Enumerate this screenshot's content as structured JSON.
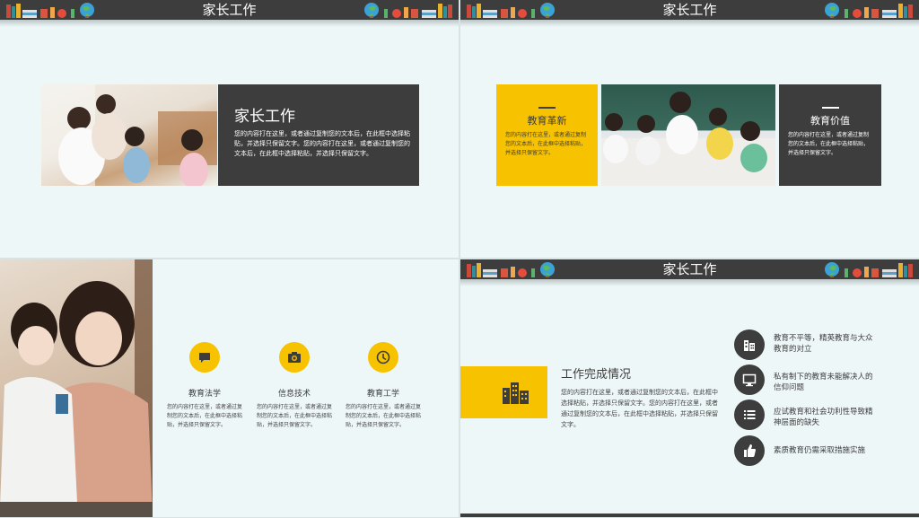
{
  "colors": {
    "dark": "#3d3d3d",
    "accent": "#f7c200",
    "bg": "#eef7f8"
  },
  "slide1": {
    "header_title": "家长工作",
    "card_title": "家长工作",
    "card_text": "您的内容打在这里，或者通过复制您的文本后，在此框中选择粘贴，并选择只保留文字。您的内容打在这里，或者通过复制您的文本后，在此框中选择粘贴，并选择只保留文字。"
  },
  "slide2": {
    "header_title": "家长工作",
    "left_title": "教育革新",
    "left_text": "您的内容打在这里，或者通过复制您的文本后，在此框中选择粘贴，并选择只保留文字。",
    "right_title": "教育价值",
    "right_text": "您的内容打在这里，或者通过复制您的文本后，在此框中选择粘贴，并选择只保留文字。"
  },
  "slide3": {
    "items": [
      {
        "icon": "chat-icon",
        "title": "教育法学",
        "text": "您的内容打在这里，或者通过复制您的文本后，在此框中选择粘贴，并选择只保留文字。"
      },
      {
        "icon": "camera-icon",
        "title": "信息技术",
        "text": "您的内容打在这里，或者通过复制您的文本后，在此框中选择粘贴，并选择只保留文字。"
      },
      {
        "icon": "clock-icon",
        "title": "教育工学",
        "text": "您的内容打在这里，或者通过复制您的文本后，在此框中选择粘贴，并选择只保留文字。"
      }
    ]
  },
  "slide4": {
    "header_title": "家长工作",
    "main_title": "工作完成情况",
    "main_text": "您的内容打在这里，或者通过复制您的文本后，在此框中选择粘贴，并选择只保留文字。您的内容打在这里，或者通过复制您的文本后，在此框中选择粘贴，并选择只保留文字。",
    "list": [
      {
        "icon": "building-icon",
        "text": "教育不平等，精英教育与大众教育的对立"
      },
      {
        "icon": "monitor-icon",
        "text": "私有制下的教育未能解决人的信仰问题"
      },
      {
        "icon": "list-icon",
        "text": "应试教育和社会功利性导致精神层面的缺失"
      },
      {
        "icon": "thumbs-up-icon",
        "text": "素质教育仍需采取措施实施"
      }
    ]
  }
}
